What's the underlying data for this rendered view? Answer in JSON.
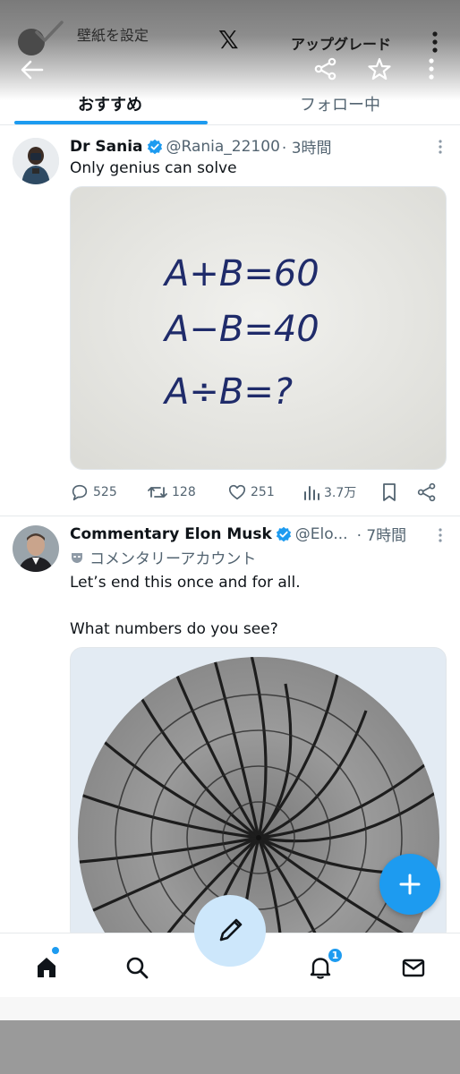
{
  "overlay": {
    "wallpaper_label": "壁紙を設定",
    "x_logo": "𝕏",
    "upgrade_label": "アップグレード"
  },
  "tabs": [
    {
      "label": "おすすめ",
      "active": true
    },
    {
      "label": "フォロー中",
      "active": false
    }
  ],
  "posts": [
    {
      "name": "Dr Sania",
      "handle": "@Rania_22100",
      "time": "· 3時間",
      "text": "Only genius can solve",
      "image_lines": [
        "A+B=60",
        "A−B=40",
        "A÷B=?"
      ],
      "stats": {
        "replies": "525",
        "reposts": "128",
        "likes": "251",
        "views": "3.7万"
      }
    },
    {
      "name": "Commentary Elon Musk",
      "handle": "@Elo...",
      "time": "· 7時間",
      "affiliation": "コメンタリーアカウント",
      "text_line1": "Let’s end this once and for all.",
      "text_line2": "What numbers do you see?"
    }
  ],
  "bottom_nav": {
    "notification_count": "1"
  },
  "colors": {
    "accent": "#1d9bf0",
    "text_primary": "#0f1419",
    "text_secondary": "#536471"
  }
}
